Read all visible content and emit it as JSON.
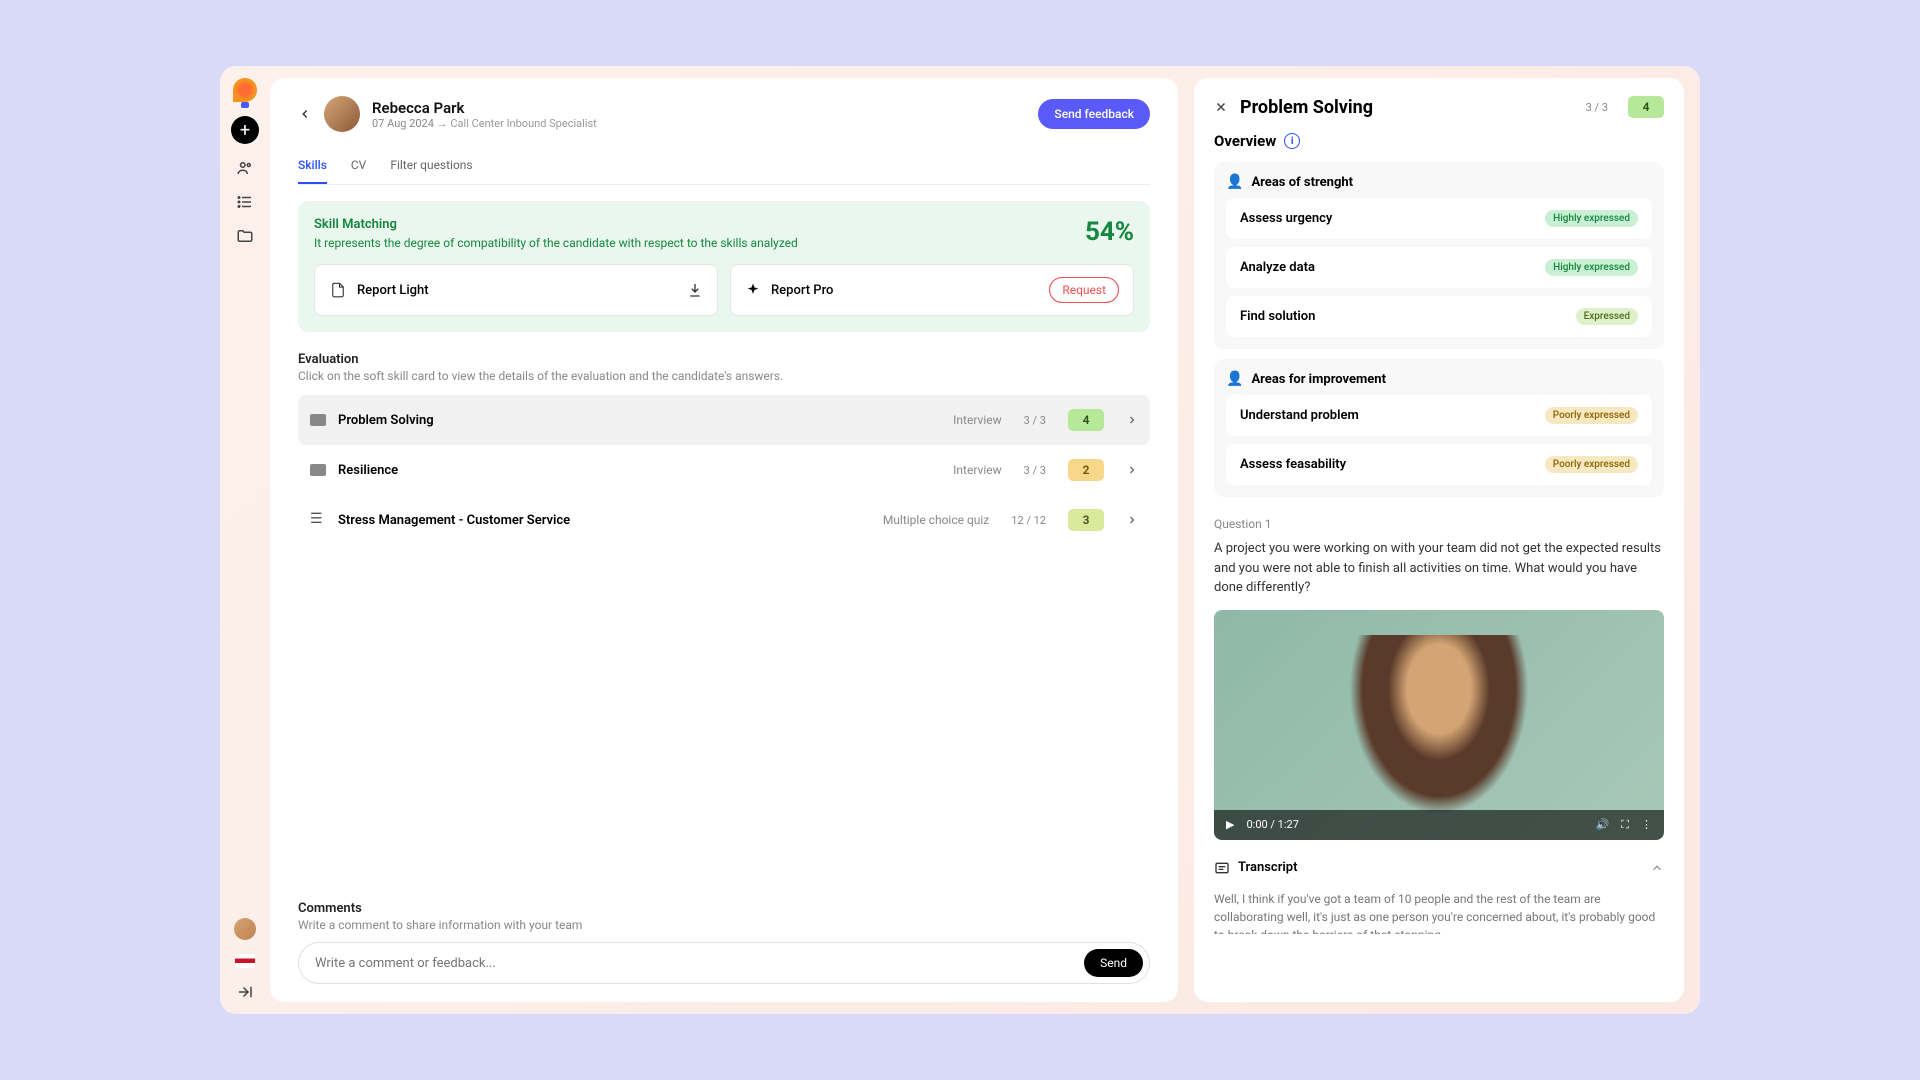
{
  "candidate": {
    "name": "Rebecca Park",
    "date": "07 Aug 2024",
    "job": "Call Center Inbound Specialist"
  },
  "actions": {
    "send_feedback": "Send feedback"
  },
  "tabs": {
    "skills": "Skills",
    "cv": "CV",
    "filter": "Filter questions"
  },
  "skill_match": {
    "title": "Skill Matching",
    "desc": "It represents the degree of compatibility of the candidate with respect to the skills analyzed",
    "pct": "54%"
  },
  "reports": {
    "light": "Report Light",
    "pro": "Report Pro",
    "request": "Request"
  },
  "evaluation": {
    "title": "Evaluation",
    "desc": "Click on the soft skill card to view the details of the evaluation and the candidate's answers."
  },
  "skills": [
    {
      "name": "Problem Solving",
      "type": "Interview",
      "count": "3 / 3",
      "score": "4",
      "score_class": "4"
    },
    {
      "name": "Resilience",
      "type": "Interview",
      "count": "3 / 3",
      "score": "2",
      "score_class": "2"
    },
    {
      "name": "Stress Management - Customer Service",
      "type": "Multiple choice quiz",
      "count": "12 / 12",
      "score": "3",
      "score_class": "3"
    }
  ],
  "comments": {
    "title": "Comments",
    "desc": "Write a comment to share information with your team",
    "placeholder": "Write a comment or feedback...",
    "send": "Send"
  },
  "detail": {
    "title": "Problem Solving",
    "count": "3 / 3",
    "score": "4",
    "overview": "Overview",
    "strength_title": "Areas of strenght",
    "strengths": [
      {
        "name": "Assess urgency",
        "tag": "Highly expressed",
        "tag_class": "high"
      },
      {
        "name": "Analyze data",
        "tag": "Highly expressed",
        "tag_class": "high"
      },
      {
        "name": "Find solution",
        "tag": "Expressed",
        "tag_class": "exp"
      }
    ],
    "improve_title": "Areas for improvement",
    "improvements": [
      {
        "name": "Understand problem",
        "tag": "Poorly expressed",
        "tag_class": "poor"
      },
      {
        "name": "Assess feasability",
        "tag": "Poorly expressed",
        "tag_class": "poor"
      }
    ],
    "question_label": "Question 1",
    "question_text": "A project you were working on with your team did not get the expected results and you were not able to finish all activities on time. What would you have done differently?",
    "video_time": "0:00 / 1:27",
    "transcript_title": "Transcript",
    "transcript_text": "Well, I think if you've got a team of 10 people and the rest of the team are collaborating well, it's just as one person you're concerned about, it's probably good to break down the barriers of that stopping"
  }
}
